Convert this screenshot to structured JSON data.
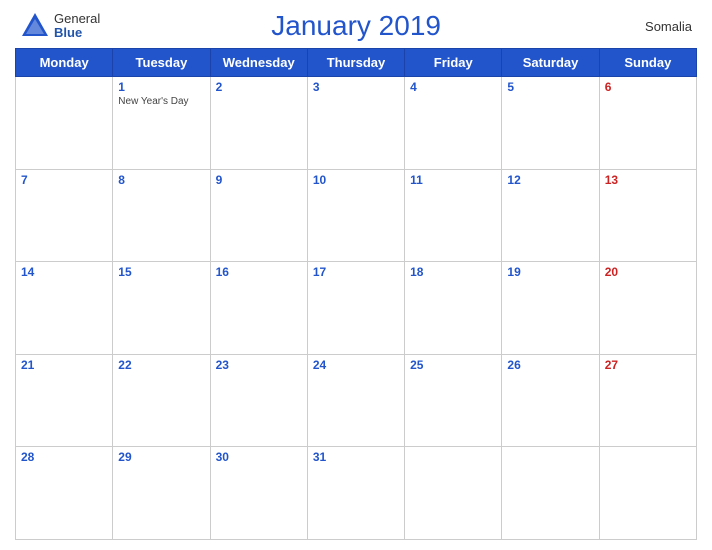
{
  "header": {
    "logo_general": "General",
    "logo_blue": "Blue",
    "title": "January 2019",
    "country": "Somalia"
  },
  "weekdays": [
    "Monday",
    "Tuesday",
    "Wednesday",
    "Thursday",
    "Friday",
    "Saturday",
    "Sunday"
  ],
  "weeks": [
    [
      {
        "day": null
      },
      {
        "day": 1,
        "holiday": "New Year's Day"
      },
      {
        "day": 2
      },
      {
        "day": 3
      },
      {
        "day": 4
      },
      {
        "day": 5
      },
      {
        "day": 6,
        "isSunday": true
      }
    ],
    [
      {
        "day": 7
      },
      {
        "day": 8
      },
      {
        "day": 9
      },
      {
        "day": 10
      },
      {
        "day": 11
      },
      {
        "day": 12
      },
      {
        "day": 13,
        "isSunday": true
      }
    ],
    [
      {
        "day": 14
      },
      {
        "day": 15
      },
      {
        "day": 16
      },
      {
        "day": 17
      },
      {
        "day": 18
      },
      {
        "day": 19
      },
      {
        "day": 20,
        "isSunday": true
      }
    ],
    [
      {
        "day": 21
      },
      {
        "day": 22
      },
      {
        "day": 23
      },
      {
        "day": 24
      },
      {
        "day": 25
      },
      {
        "day": 26
      },
      {
        "day": 27,
        "isSunday": true
      }
    ],
    [
      {
        "day": 28
      },
      {
        "day": 29
      },
      {
        "day": 30
      },
      {
        "day": 31
      },
      {
        "day": null
      },
      {
        "day": null
      },
      {
        "day": null
      }
    ]
  ]
}
